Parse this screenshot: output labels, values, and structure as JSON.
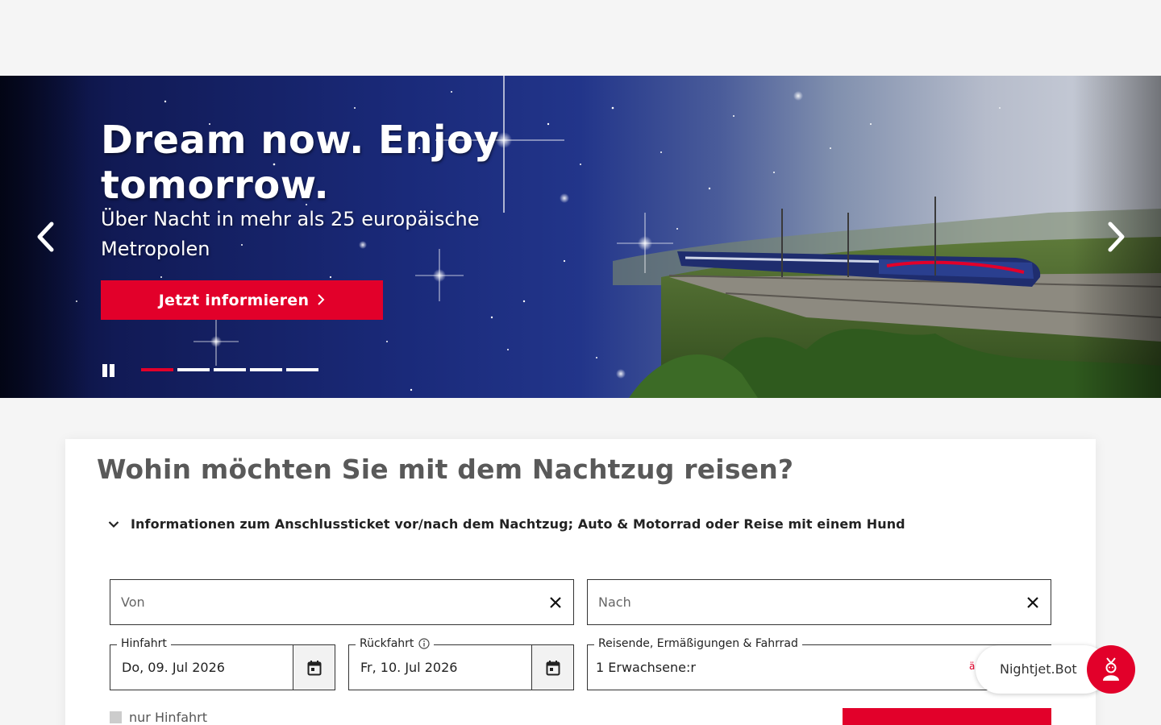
{
  "hero": {
    "title": "Dream now. Enjoy tomorrow.",
    "subtitle": "Über Nacht in mehr als 25 europäische Metropolen",
    "cta_label": "Jetzt informieren",
    "slide_count": 5,
    "active_slide": 1
  },
  "booking": {
    "title": "Wohin möchten Sie mit dem Nachtzug reisen?",
    "info_toggle": "Informationen zum Anschlussticket vor/nach dem Nachtzug; Auto & Motorrad oder Reise mit einem Hund",
    "from_placeholder": "Von",
    "to_placeholder": "Nach",
    "outbound_label": "Hinfahrt",
    "outbound_value": "Do, 09. Jul 2026",
    "return_label": "Rückfahrt",
    "return_value": "Fr, 10. Jul 2026",
    "passengers_label": "Reisende, Ermäßigungen & Fahrrad",
    "passengers_value": "1 Erwachsene:r",
    "passengers_change_partial": "ä",
    "only_outbound_label": "nur Hinfahrt"
  },
  "chatbot": {
    "label": "Nightjet.Bot"
  },
  "colors": {
    "accent": "#e2002a",
    "page_bg": "#f5f5f5"
  }
}
